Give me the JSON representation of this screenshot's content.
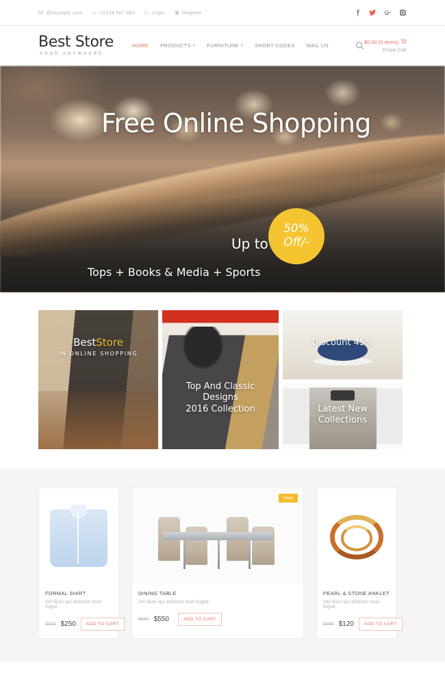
{
  "topbar": {
    "email": "@example.com",
    "phone": "+1234 567 892",
    "login": "Login",
    "register": "Register",
    "socials": [
      {
        "name": "facebook-icon"
      },
      {
        "name": "twitter-icon"
      },
      {
        "name": "google-plus-icon"
      },
      {
        "name": "instagram-icon"
      }
    ]
  },
  "header": {
    "logo_main": "Best Store",
    "logo_sub": "SHOP ANYWHERE",
    "nav": [
      {
        "label": "HOME",
        "caret": "",
        "active": true
      },
      {
        "label": "PRODUCTS",
        "caret": "▾",
        "active": false
      },
      {
        "label": "FURNITURE",
        "caret": "▾",
        "active": false
      },
      {
        "label": "SHORT CODES",
        "caret": "",
        "active": false
      },
      {
        "label": "MAIL US",
        "caret": "",
        "active": false
      }
    ],
    "cart_total": "$0.00 (0 items)",
    "cart_status": "Empty Cart",
    "accent_color": "#e8705b"
  },
  "hero": {
    "title": "Free Online Shopping",
    "upto": "Up to",
    "badge_line1": "50%",
    "badge_line2": "Off/-",
    "subtitle": "Tops + Books & Media + Sports",
    "badge_color": "#f5c431",
    "active_dot_color": "#e8a820",
    "slides": 3,
    "active_slide": 3
  },
  "promo": {
    "tiles": [
      {
        "name": "best-store-tile",
        "line1_a": "Best",
        "line1_b": "Store",
        "line2": "IN ONLINE SHOPPING"
      },
      {
        "name": "discount-tile",
        "caption": "Discount 45%"
      },
      {
        "name": "latest-collections-tile",
        "caption": "Latest New\nCollections",
        "l1": "Latest New",
        "l2": "Collections"
      },
      {
        "name": "top-classic-tile",
        "l1": "Top And Classic",
        "l2": "Designs",
        "l3": "2016 Collection"
      }
    ]
  },
  "products": [
    {
      "title": "FORMAL SHIRT",
      "desc": "Vel illum qui dolorem eum fugiat.",
      "old_price": "$325",
      "new_price": "$250",
      "cta": "ADD TO CART",
      "badge": ""
    },
    {
      "title": "DINING TABLE",
      "desc": "Vel illum qui dolorem eum fugiat.",
      "old_price": "$680",
      "new_price": "$550",
      "cta": "ADD TO CART",
      "badge": "New"
    },
    {
      "title": "PEARL & STONE ANKLET",
      "desc": "Vel illum qui dolorem eum fugiat.",
      "old_price": "$180",
      "new_price": "$120",
      "cta": "ADD TO CART",
      "badge": ""
    }
  ]
}
